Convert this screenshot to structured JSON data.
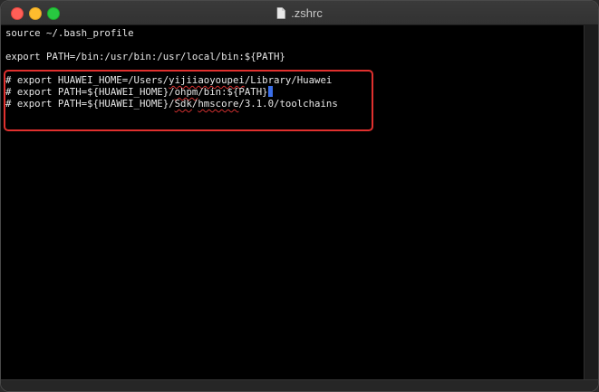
{
  "window": {
    "title": ".zshrc",
    "colors": {
      "close": "#ff5f57",
      "minimize": "#febc2e",
      "maximize": "#28c840",
      "highlight_box": "#e0302e",
      "cursor": "#3a6ee8"
    }
  },
  "editor": {
    "line1": "source ~/.bash_profile",
    "line2": "export PATH=/bin:/usr/bin:/usr/local/bin:${PATH}",
    "line3": {
      "prefix": "# export HUAWEI_HOME=/Users/",
      "word": "yijiiaoyoupei",
      "suffix": "/Library/Huawei"
    },
    "line4": {
      "prefix": "# export PATH=${HUAWEI_HOME}/",
      "word": "ohpm",
      "suffix": "/bin:${PATH}"
    },
    "line5": {
      "prefix": "# export PATH=${HUAWEI_HOME}/",
      "word1": "Sdk",
      "mid": "/",
      "word2": "hmscore",
      "suffix": "/3.1.0/toolchains"
    }
  }
}
